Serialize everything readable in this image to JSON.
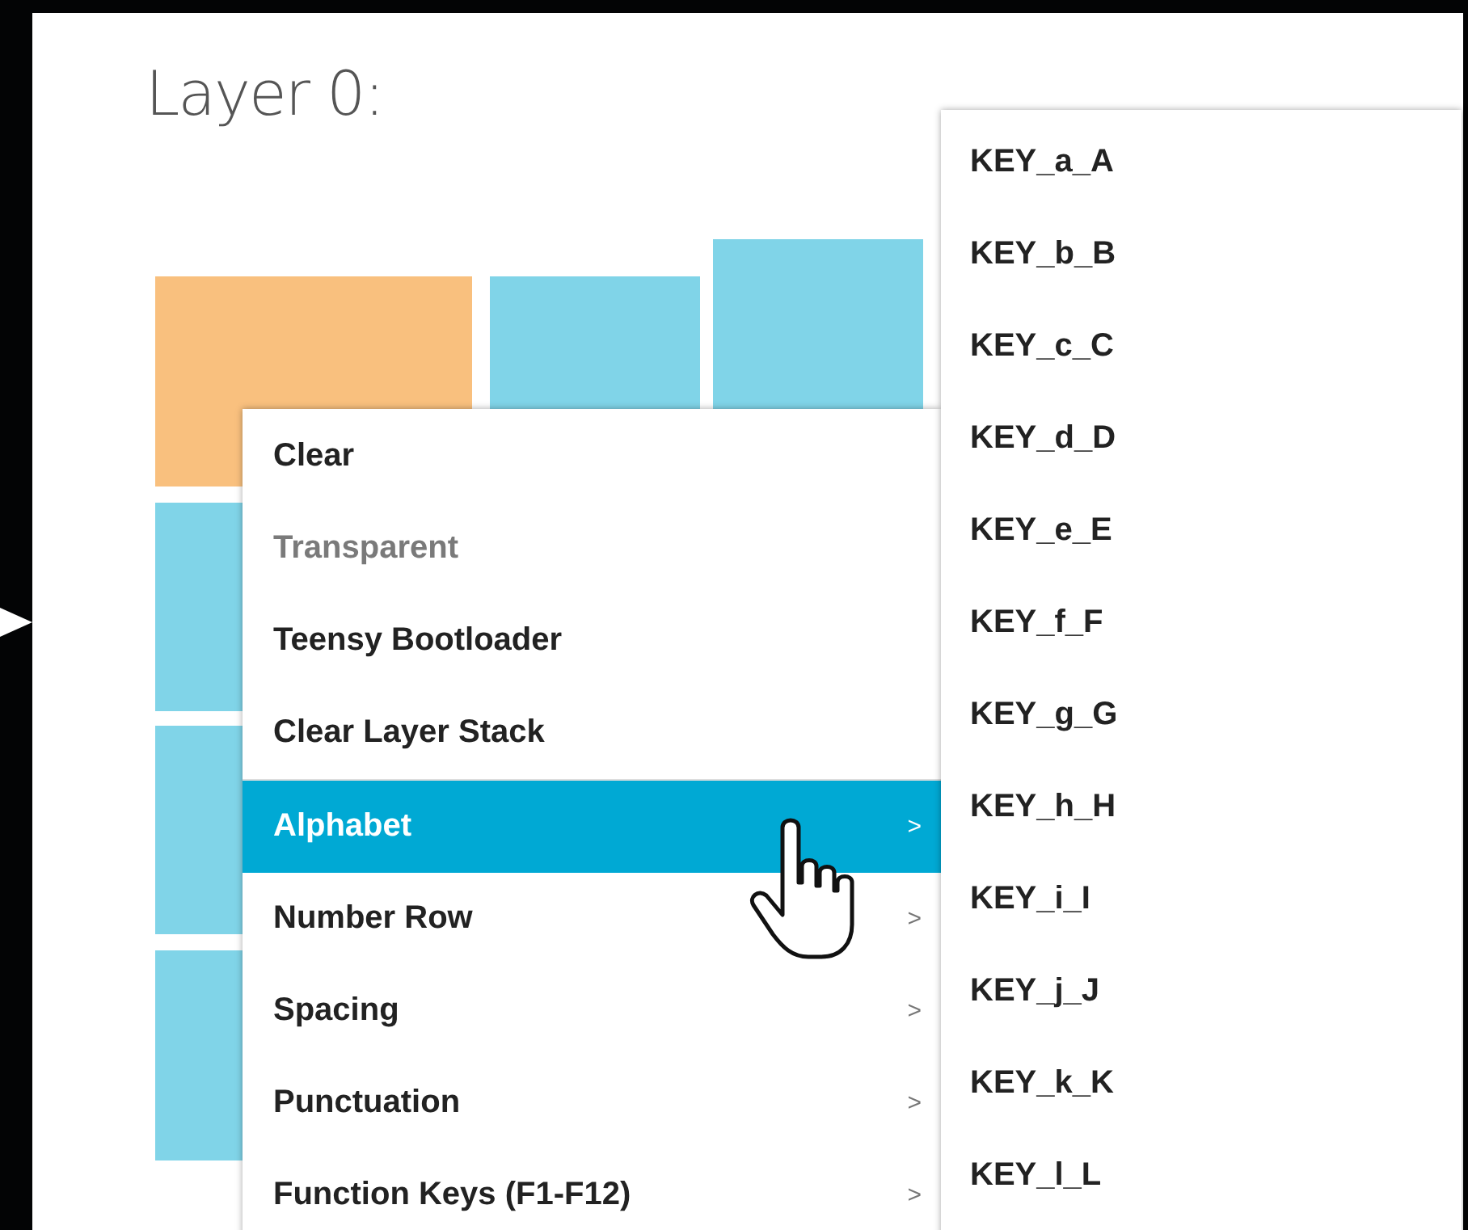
{
  "panel": {
    "title": "Layer 0:"
  },
  "keys": [
    {
      "selected": true
    },
    {
      "selected": false
    },
    {
      "selected": false
    },
    {
      "selected": false
    },
    {
      "selected": false
    },
    {
      "selected": false
    }
  ],
  "context_menu": {
    "items": [
      {
        "label": "Clear",
        "kind": "action",
        "disabled": false,
        "selected": false
      },
      {
        "label": "Transparent",
        "kind": "action",
        "disabled": true,
        "selected": false
      },
      {
        "label": "Teensy Bootloader",
        "kind": "action",
        "disabled": false,
        "selected": false
      },
      {
        "label": "Clear Layer Stack",
        "kind": "action",
        "disabled": false,
        "selected": false
      },
      {
        "label": "Alphabet",
        "kind": "submenu",
        "arrow": ">",
        "disabled": false,
        "selected": true
      },
      {
        "label": "Number Row",
        "kind": "submenu",
        "arrow": ">",
        "disabled": false,
        "selected": false
      },
      {
        "label": "Spacing",
        "kind": "submenu",
        "arrow": ">",
        "disabled": false,
        "selected": false
      },
      {
        "label": "Punctuation",
        "kind": "submenu",
        "arrow": ">",
        "disabled": false,
        "selected": false
      },
      {
        "label": "Function Keys (F1-F12)",
        "kind": "submenu",
        "arrow": ">",
        "disabled": false,
        "selected": false
      }
    ]
  },
  "submenu": {
    "items": [
      "KEY_a_A",
      "KEY_b_B",
      "KEY_c_C",
      "KEY_d_D",
      "KEY_e_E",
      "KEY_f_F",
      "KEY_g_G",
      "KEY_h_H",
      "KEY_i_I",
      "KEY_j_J",
      "KEY_k_K",
      "KEY_l_L"
    ]
  }
}
